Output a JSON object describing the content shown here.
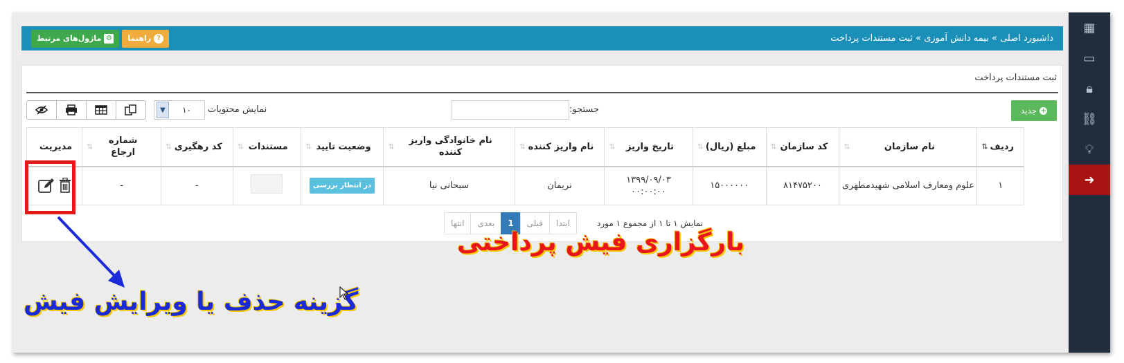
{
  "breadcrumb": {
    "items": [
      "داشبورد اصلی",
      "بیمه دانش آموزی",
      "ثبت مستندات پرداخت"
    ],
    "separator": "»"
  },
  "top_buttons": {
    "help_label": "راهنما",
    "modules_label": "ماژول‌های مرتبط"
  },
  "panel": {
    "title": "ثبت مستندات پرداخت",
    "new_button": "جدید",
    "search_label": "جستجو:",
    "search_value": "",
    "length_label": "نمایش محتویات",
    "length_value": "۱۰"
  },
  "table": {
    "headers": [
      "ردیف",
      "نام سازمان",
      "کد سازمان",
      "مبلغ (ریال)",
      "تاریخ واریز",
      "نام واریز کننده",
      "نام خانوادگی واریز کننده",
      "وضعیت تایید",
      "مستندات",
      "کد رهگیری",
      "شماره ارجاع",
      "مدیریت"
    ],
    "rows": [
      {
        "row_no": "۱",
        "org_name": "علوم ومعارف اسلامی شهیدمطهری",
        "org_code": "۸۱۴۷۵۲۰۰",
        "amount": "۱۵۰۰۰۰۰۰",
        "date": "۱۳۹۹/۰۹/۰۳",
        "time": "۰۰:۰۰:۰۰",
        "first_name": "نریمان",
        "last_name": "سبحانی نیا",
        "status": "در انتظار بررسی",
        "tracking_code": "-",
        "reference_no": "-"
      }
    ]
  },
  "footer": {
    "info": "نمایش ۱ تا ۱ از مجموع ۱ مورد",
    "pager": [
      "ابتدا",
      "قبلی",
      "1",
      "بعدی",
      "انتها"
    ]
  },
  "annotations": {
    "title": "بارگزاری فیش پرداختی",
    "hint": "گزینه حذف یا ویرایش فیش"
  },
  "colors": {
    "topbar": "#1a8fb8",
    "sidebar": "#1f2d3d",
    "sidebar_active": "#a81414",
    "new_button": "#5cb85c",
    "status_badge": "#5bc0de",
    "annotation_red": "#e8161c",
    "annotation_blue": "#1a2ad8",
    "highlight_box": "#e31a1a"
  },
  "icons": [
    "apps-grid-icon",
    "monitor-icon",
    "lock-icon",
    "link-icon",
    "lightbulb-icon",
    "logout-icon",
    "question-icon",
    "gears-icon",
    "plus-circle-icon",
    "eye-slash-icon",
    "print-icon",
    "table-icon",
    "copy-icon",
    "edit-icon",
    "trash-icon"
  ]
}
